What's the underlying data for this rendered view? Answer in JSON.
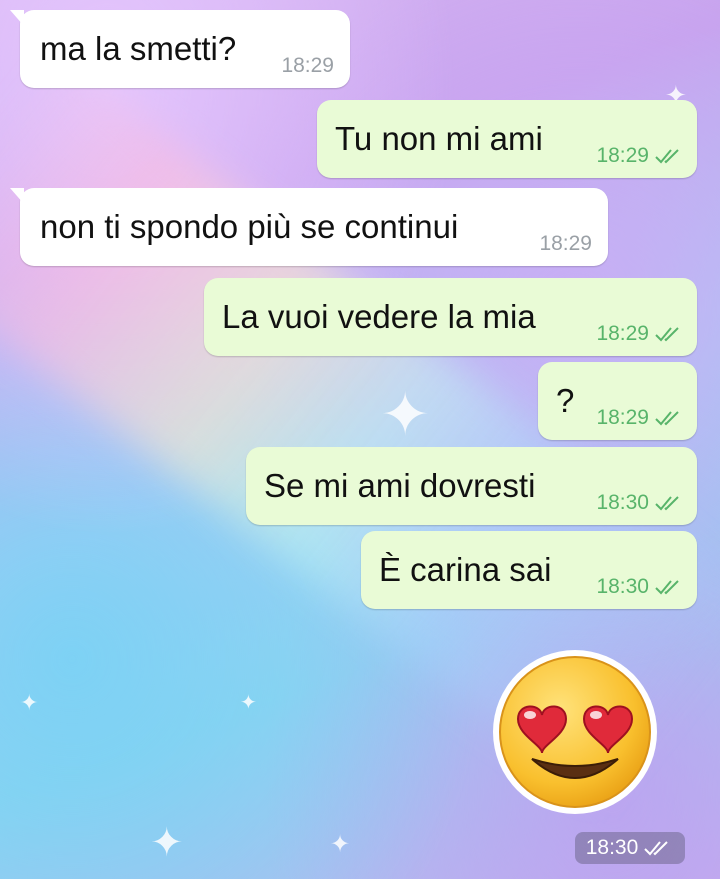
{
  "messages": [
    {
      "direction": "in",
      "text": "ma la smetti?",
      "time": "18:29"
    },
    {
      "direction": "out",
      "text": "Tu non mi ami",
      "time": "18:29",
      "status": "read"
    },
    {
      "direction": "in",
      "text": "non ti spondo più se continui",
      "time": "18:29"
    },
    {
      "direction": "out",
      "text": "La vuoi vedere la mia",
      "time": "18:29",
      "status": "read"
    },
    {
      "direction": "out",
      "text": "?",
      "time": "18:29",
      "status": "read"
    },
    {
      "direction": "out",
      "text": "Se mi ami dovresti",
      "time": "18:30",
      "status": "read"
    },
    {
      "direction": "out",
      "text": "È carina sai",
      "time": "18:30",
      "status": "read"
    }
  ],
  "sticker": {
    "emoji": "heart-eyes-smiley",
    "time": "18:30",
    "status": "read"
  },
  "colors": {
    "incoming_bubble": "#ffffff",
    "outgoing_bubble": "#e9fbd6",
    "read_check": "#58b46a"
  }
}
